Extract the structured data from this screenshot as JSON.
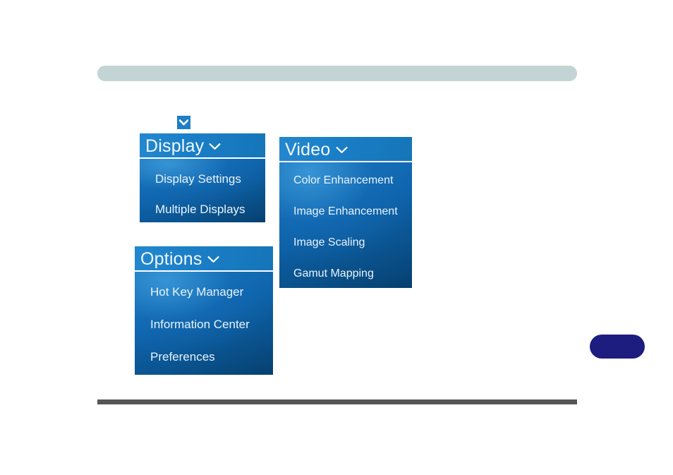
{
  "page": {
    "background_color": "#ffffff",
    "header_bar_color": "#c2d5d4",
    "footer_rule_color": "#565656",
    "side_tab_color": "#1d1d80"
  },
  "toggle": {
    "icon": "chevron-down-icon",
    "background_color": "#1f7ec4",
    "glyph_color": "#ffffff"
  },
  "panels": [
    {
      "id": "display",
      "title": "Display",
      "caret_icon": "chevron-down-icon",
      "header_color": "#1a7ec6",
      "body_color": "#0c62ac",
      "items": [
        {
          "label": "Display Settings"
        },
        {
          "label": "Multiple Displays"
        }
      ]
    },
    {
      "id": "video",
      "title": "Video",
      "caret_icon": "chevron-down-icon",
      "header_color": "#1a7ec6",
      "body_color": "#0c62ac",
      "items": [
        {
          "label": "Color Enhancement"
        },
        {
          "label": "Image Enhancement"
        },
        {
          "label": "Image Scaling"
        },
        {
          "label": "Gamut Mapping"
        }
      ]
    },
    {
      "id": "options",
      "title": "Options",
      "caret_icon": "chevron-down-icon",
      "header_color": "#1a7ec6",
      "body_color": "#0c62ac",
      "items": [
        {
          "label": "Hot Key Manager"
        },
        {
          "label": "Information Center"
        },
        {
          "label": "Preferences"
        }
      ]
    }
  ]
}
